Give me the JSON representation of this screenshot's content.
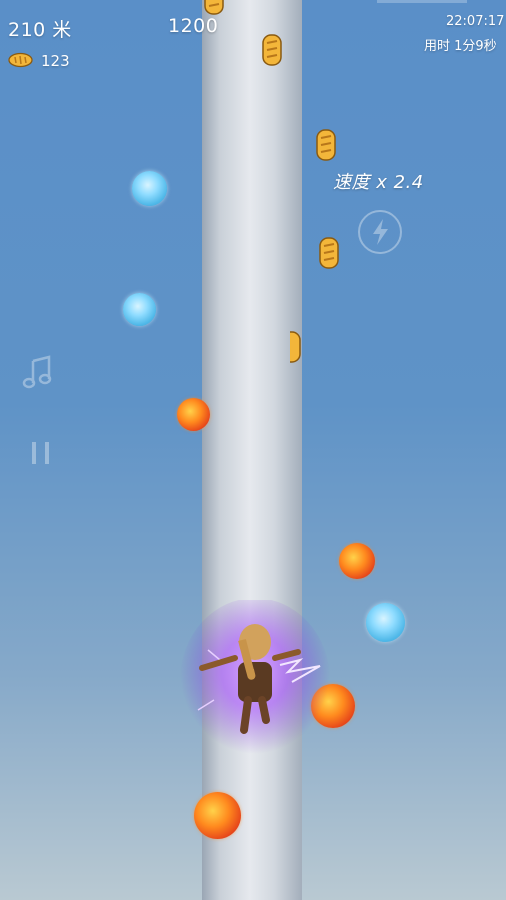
{
  "hud": {
    "distance": "210 米",
    "score": "1200",
    "bread_count": "123",
    "clock": "22:07:17",
    "elapsed": "用时 1分9秒",
    "speed": "速度 x 2.4"
  },
  "icons": {
    "bread": "bread-icon",
    "speed": "lightning-bolt-icon",
    "music": "music-note-icon",
    "pause": "pause-icon"
  },
  "colors": {
    "sky_top": "#5a8fc8",
    "pillar": "#e6e9ee",
    "ice_orb": "#8fdcff",
    "fire_orb": "#ff8a1e",
    "aura": "#a040ff"
  }
}
